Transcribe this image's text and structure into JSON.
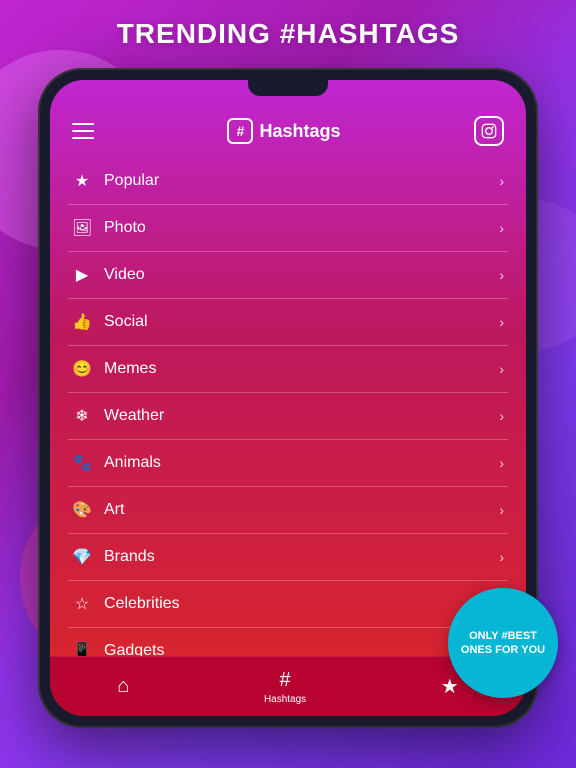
{
  "page": {
    "header_title": "TRENDING #HASHTAGS"
  },
  "app": {
    "title": "Hashtags",
    "hash_symbol": "#"
  },
  "menu_items": [
    {
      "id": "popular",
      "icon": "★",
      "label": "Popular"
    },
    {
      "id": "photo",
      "icon": "🖼",
      "label": "Photo"
    },
    {
      "id": "video",
      "icon": "▶",
      "label": "Video"
    },
    {
      "id": "social",
      "icon": "👍",
      "label": "Social"
    },
    {
      "id": "memes",
      "icon": "😊",
      "label": "Memes"
    },
    {
      "id": "weather",
      "icon": "❄",
      "label": "Weather"
    },
    {
      "id": "animals",
      "icon": "🐾",
      "label": "Animals"
    },
    {
      "id": "art",
      "icon": "🎨",
      "label": "Art"
    },
    {
      "id": "brands",
      "icon": "💎",
      "label": "Brands"
    },
    {
      "id": "celebrities",
      "icon": "☆",
      "label": "Celebrities"
    },
    {
      "id": "gadgets",
      "icon": "📱",
      "label": "Gadgets"
    }
  ],
  "bottom_nav": [
    {
      "id": "home",
      "icon": "⌂",
      "label": ""
    },
    {
      "id": "hashtags",
      "icon": "#",
      "label": "Hashtags",
      "active": true
    },
    {
      "id": "favorites",
      "icon": "★",
      "label": ""
    }
  ],
  "promo_badge": {
    "line1": "ONLY #BEST",
    "line2": "ONES FOR YOU"
  }
}
